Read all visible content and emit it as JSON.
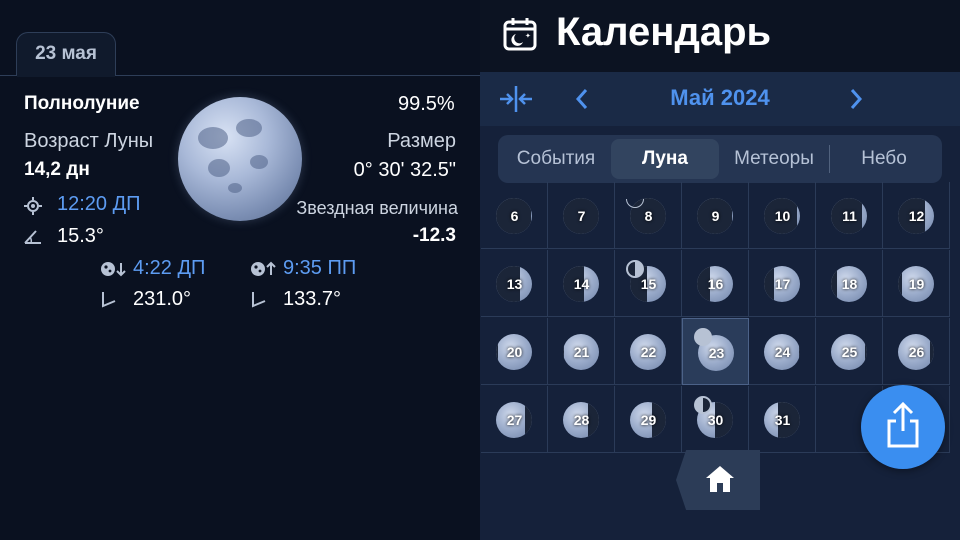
{
  "left": {
    "date_tab": "23 мая",
    "phase_name": "Полнолуние",
    "illumination": "99.5%",
    "age_label": "Возраст Луны",
    "age_value": "14,2 дн",
    "size_label": "Размер",
    "size_value": "0° 30' 32.5\"",
    "transit_time": "12:20 ДП",
    "transit_altitude": "15.3°",
    "magnitude_label": "Звездная величина",
    "magnitude_value": "-12.3",
    "moonset_time": "4:22 ДП",
    "moonset_azimuth": "231.0°",
    "moonrise_time": "9:35 ПП",
    "moonrise_azimuth": "133.7°"
  },
  "right": {
    "title": "Календарь",
    "month": "Май 2024",
    "segments": [
      "События",
      "Луна",
      "Метеоры",
      "Небо"
    ],
    "active_segment": "Луна",
    "days": [
      {
        "d": "6",
        "lit": 0.02
      },
      {
        "d": "7",
        "lit": 0.01
      },
      {
        "d": "8",
        "lit": 0.0
      },
      {
        "d": "9",
        "lit": 0.03
      },
      {
        "d": "10",
        "lit": 0.08
      },
      {
        "d": "11",
        "lit": 0.15
      },
      {
        "d": "12",
        "lit": 0.24
      },
      {
        "d": "13",
        "lit": 0.33
      },
      {
        "d": "14",
        "lit": 0.43
      },
      {
        "d": "15",
        "lit": 0.53
      },
      {
        "d": "16",
        "lit": 0.63
      },
      {
        "d": "17",
        "lit": 0.73
      },
      {
        "d": "18",
        "lit": 0.82
      },
      {
        "d": "19",
        "lit": 0.89
      },
      {
        "d": "20",
        "lit": 0.95
      },
      {
        "d": "21",
        "lit": 0.98
      },
      {
        "d": "22",
        "lit": 1.0
      },
      {
        "d": "23",
        "lit": 1.0
      },
      {
        "d": "24",
        "lit": 0.98
      },
      {
        "d": "25",
        "lit": 0.94
      },
      {
        "d": "26",
        "lit": 0.88
      },
      {
        "d": "27",
        "lit": 0.8
      },
      {
        "d": "28",
        "lit": 0.7
      },
      {
        "d": "29",
        "lit": 0.6
      },
      {
        "d": "30",
        "lit": 0.5
      },
      {
        "d": "31",
        "lit": 0.4
      }
    ],
    "selected_day": "23",
    "colors": {
      "accent": "#3a8ef0",
      "month": "#4f92ee"
    }
  }
}
